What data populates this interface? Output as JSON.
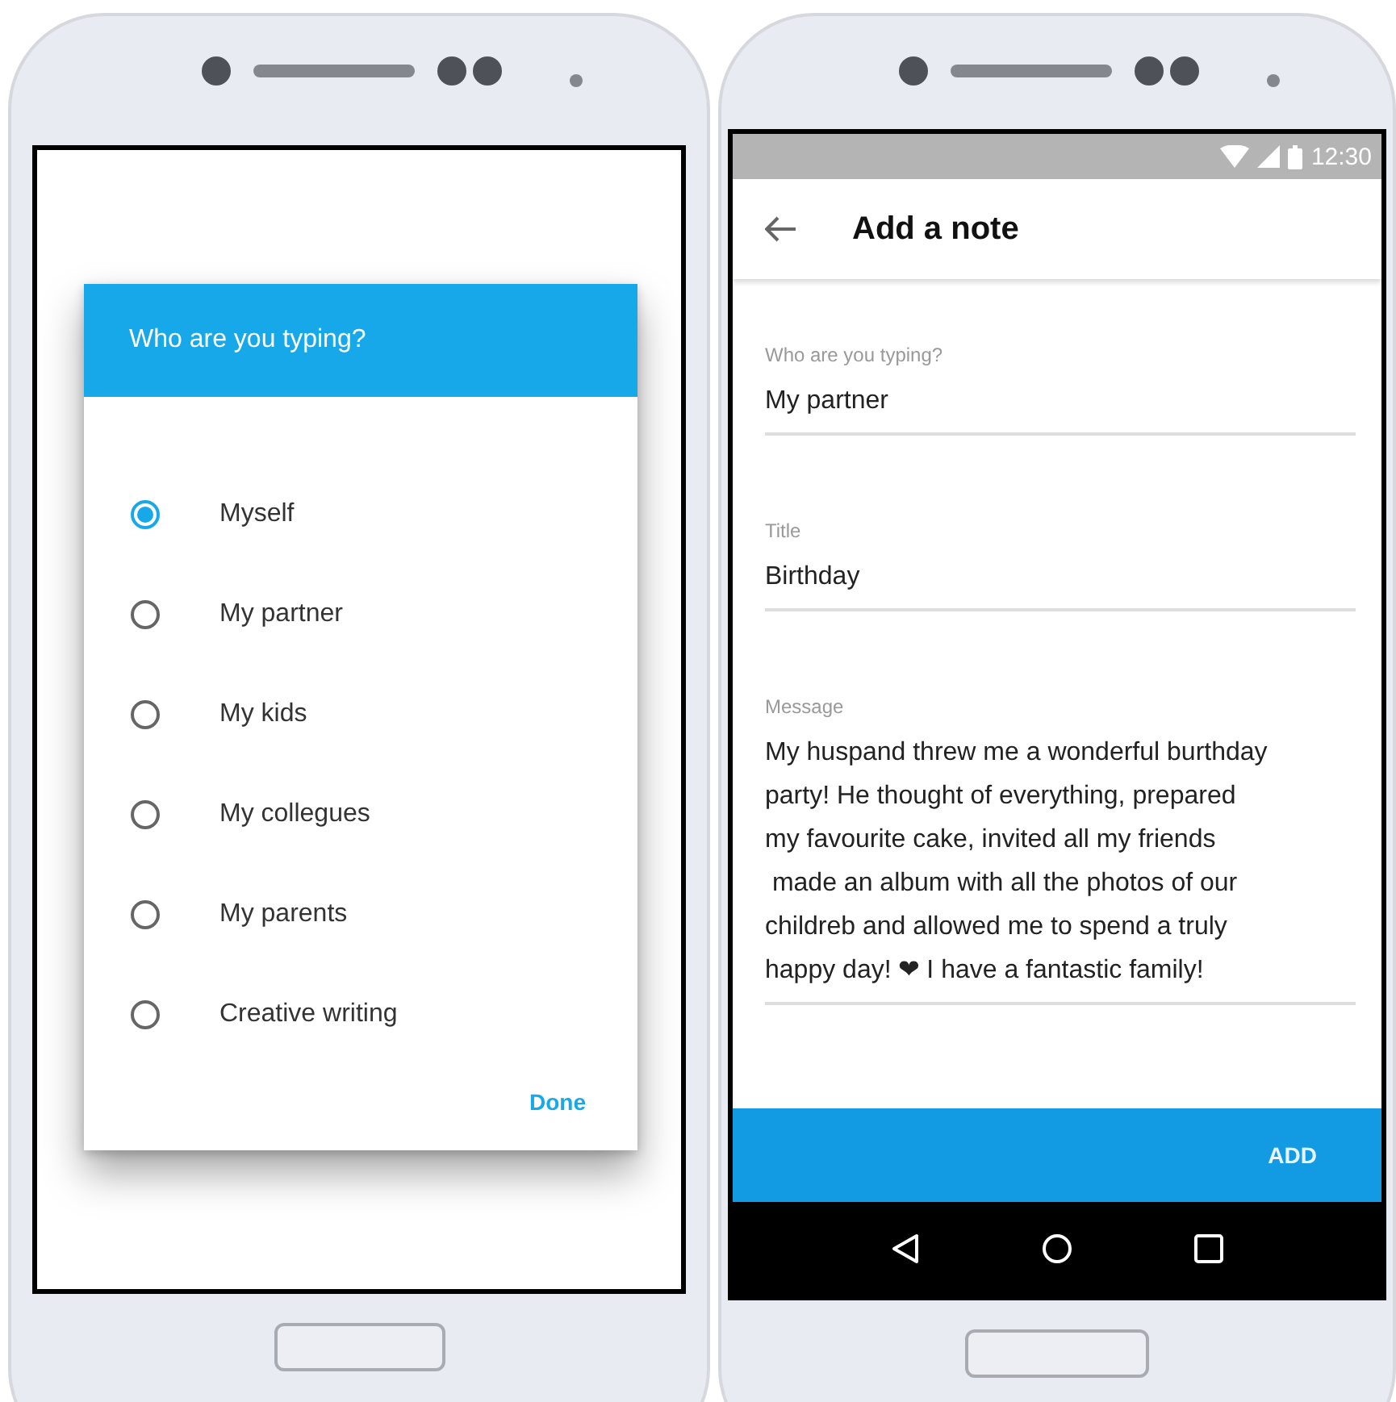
{
  "dialog_phone": {
    "dialog": {
      "title": "Who are you typing?",
      "options": [
        {
          "label": "Myself",
          "selected": true
        },
        {
          "label": "My partner",
          "selected": false
        },
        {
          "label": "My kids",
          "selected": false
        },
        {
          "label": "My collegues",
          "selected": false
        },
        {
          "label": "My parents",
          "selected": false
        },
        {
          "label": "Creative writing",
          "selected": false
        }
      ],
      "button": "Done"
    }
  },
  "note_phone": {
    "status_bar": {
      "time": "12:30"
    },
    "app_bar": {
      "title": "Add a note"
    },
    "fields": [
      {
        "label": "Who are you typing?",
        "value": "My partner"
      },
      {
        "label": "Title",
        "value": "Birthday"
      },
      {
        "label": "Message",
        "value": "My huspand threw me a wonderful burthday\nparty! He thought of everything, prepared\nmy favourite cake, invited all my friends\n made an album with all the photos of our\nchildreb and allowed me to spend a truly\nhappy day! ❤ I have a fantastic family!"
      }
    ],
    "button": "ADD"
  }
}
